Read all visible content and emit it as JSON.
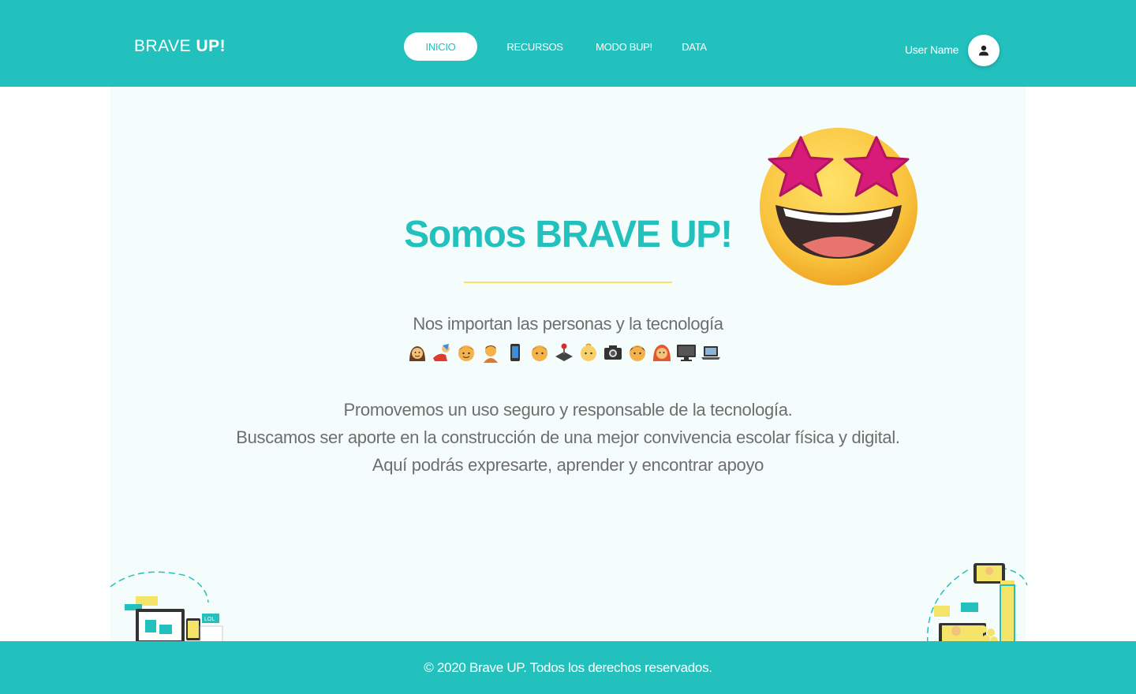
{
  "header": {
    "logo_light": "BRAVE",
    "logo_bold": "UP!",
    "nav": [
      {
        "label": "INICIO",
        "active": true
      },
      {
        "label": "RECURSOS",
        "active": false
      },
      {
        "label": "MODO BUP!",
        "active": false
      },
      {
        "label": "DATA",
        "active": false
      }
    ],
    "user_name": "User Name"
  },
  "hero": {
    "title_prefix": "Somos",
    "title_brand": "BRAVE UP!",
    "subtitle": "Nos importan las personas y la tecnología",
    "emojis": [
      "woman-icon",
      "selfie-icon",
      "boy-icon",
      "person-icon",
      "phone-icon",
      "boy-icon",
      "joystick-icon",
      "baby-icon",
      "camera-icon",
      "man-icon",
      "woman-red-hair-icon",
      "desktop-icon",
      "laptop-icon"
    ],
    "paragraph": [
      "Promovemos un uso seguro y responsable de la tecnología.",
      "Buscamos ser aporte en la construcción de una mejor convivencia escolar física y digital.",
      "Aquí podrás expresarte, aprender y encontrar apoyo"
    ]
  },
  "footer": {
    "copyright": "© 2020 Brave UP. Todos los derechos reservados."
  },
  "colors": {
    "brand": "#22c1bd",
    "accent_line": "#f4e46a",
    "text_gray": "#6e6e6e",
    "panel_bg": "#f5fcfc"
  }
}
